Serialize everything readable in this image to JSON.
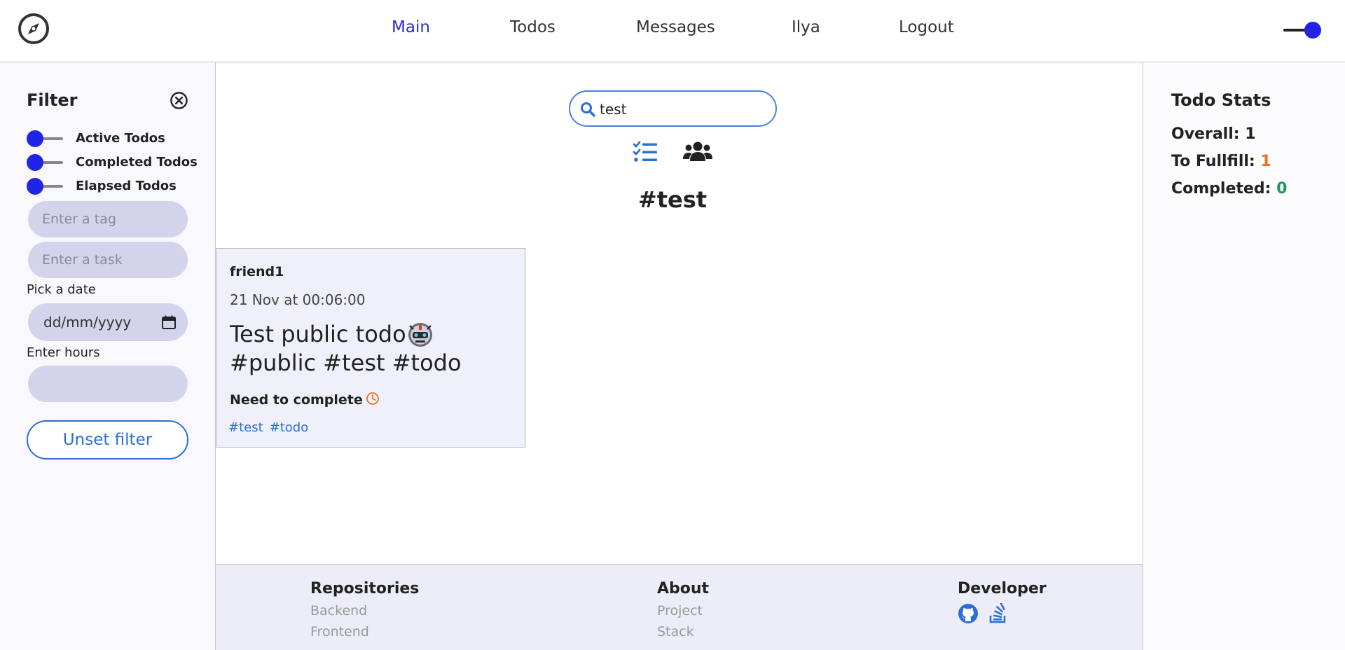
{
  "nav": {
    "items": [
      {
        "label": "Main",
        "active": true
      },
      {
        "label": "Todos",
        "active": false
      },
      {
        "label": "Messages",
        "active": false
      },
      {
        "label": "Ilya",
        "active": false
      },
      {
        "label": "Logout",
        "active": false
      }
    ]
  },
  "filter": {
    "title": "Filter",
    "toggles": [
      {
        "label": "Active Todos"
      },
      {
        "label": "Completed Todos"
      },
      {
        "label": "Elapsed Todos"
      }
    ],
    "tag_placeholder": "Enter a tag",
    "task_placeholder": "Enter a task",
    "date_label": "Pick a date",
    "date_placeholder": "dd/mm/yyyy",
    "hours_label": "Enter hours",
    "hours_value": "",
    "unset_label": "Unset filter"
  },
  "search": {
    "value": "test"
  },
  "tag_heading": "#test",
  "todo": {
    "owner": "friend1",
    "date": "21 Nov at 00:06:00",
    "text_before": "Test public todo",
    "text_after": "#public #test #todo",
    "status": "Need to complete",
    "tags": [
      "#test",
      "#todo"
    ]
  },
  "stats": {
    "title": "Todo Stats",
    "overall_label": "Overall:",
    "overall_value": "1",
    "fulfill_label": "To Fullfill:",
    "fulfill_value": "1",
    "completed_label": "Completed:",
    "completed_value": "0"
  },
  "footer": {
    "repositories": {
      "title": "Repositories",
      "links": [
        "Backend",
        "Frontend"
      ]
    },
    "about": {
      "title": "About",
      "links": [
        "Project",
        "Stack"
      ]
    },
    "developer": {
      "title": "Developer",
      "icons": [
        "github-icon",
        "stackoverflow-icon"
      ]
    }
  },
  "colors": {
    "accent": "#2323e6",
    "link": "#2b6fd6",
    "orange": "#f07022",
    "green": "#1f9a5a",
    "pill": "#d4d3ec",
    "card": "#f0f0fb"
  }
}
